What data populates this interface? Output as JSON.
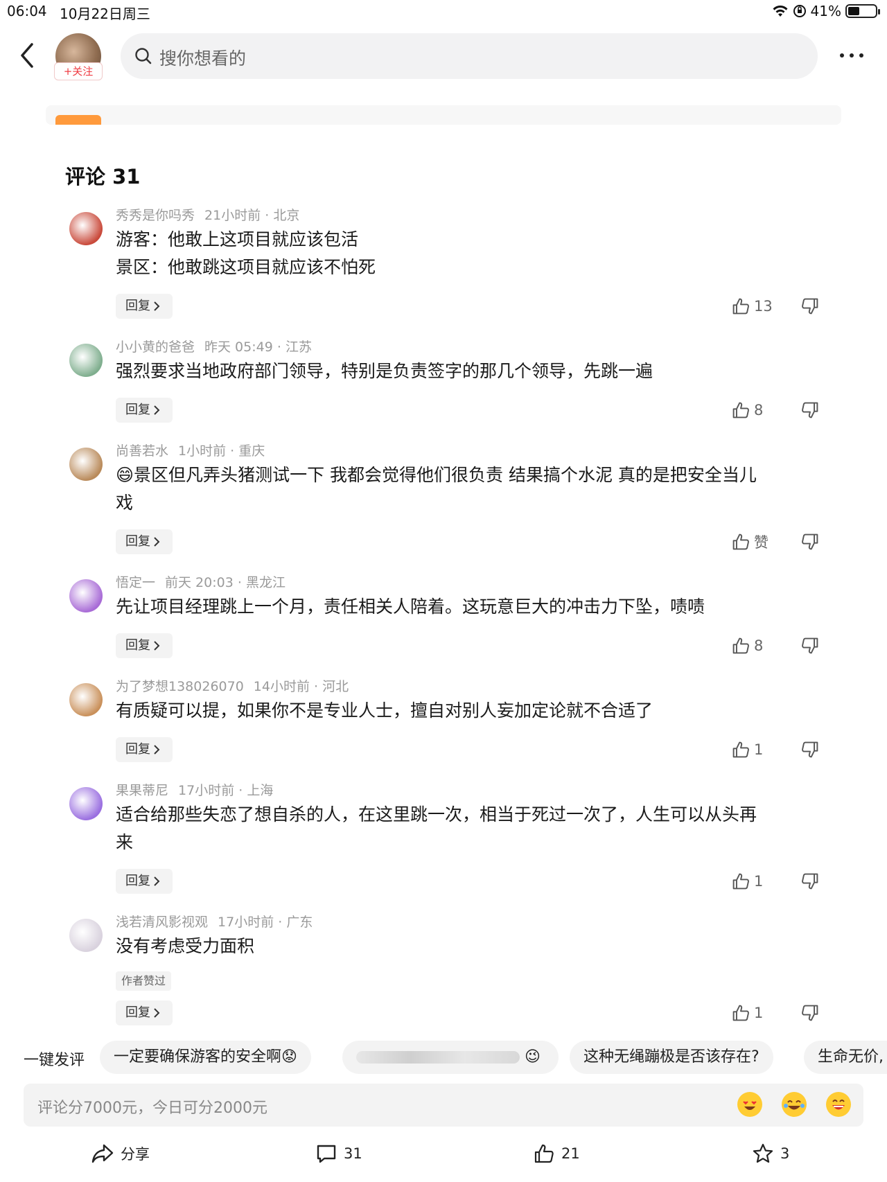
{
  "status_bar": {
    "time": "06:04",
    "date": "10月22日周三",
    "battery_text": "41%",
    "battery_level": 0.41
  },
  "top_nav": {
    "follow_label": "+关注",
    "search_placeholder": "搜你想看的"
  },
  "comments_header": {
    "title": "评论 31"
  },
  "comments": [
    {
      "author": "秀秀是你吗秀",
      "time": "21小时前",
      "location": "北京",
      "lines": [
        "游客：他敢上这项目就应该包活",
        "景区：他敢跳这项目就应该不怕死"
      ],
      "reply_label": "回复",
      "likes": "13",
      "avatar_color": "#c94a3b"
    },
    {
      "author": "小小黄的爸爸",
      "time": "昨天 05:49",
      "location": "江苏",
      "lines": [
        "强烈要求当地政府部门领导，特别是负责签字的那几个领导，先跳一遍"
      ],
      "reply_label": "回复",
      "likes": "8",
      "avatar_color": "#7fae8e"
    },
    {
      "author": "尚善若水",
      "time": "1小时前",
      "location": "重庆",
      "lines": [
        "😄景区但凡弄头猪测试一下 我都会觉得他们很负责 结果搞个水泥 真的是把安全当儿",
        "戏"
      ],
      "reply_label": "回复",
      "likes": "赞",
      "avatar_color": "#b98a5a"
    },
    {
      "author": "悟定一",
      "time": "前天 20:03",
      "location": "黑龙江",
      "lines": [
        "先让项目经理跳上一个月，责任相关人陪着。这玩意巨大的冲击力下坠，啧啧"
      ],
      "reply_label": "回复",
      "likes": "8",
      "avatar_color": "#a86bd6"
    },
    {
      "author": "为了梦想138026070",
      "time": "14小时前",
      "location": "河北",
      "lines": [
        "有质疑可以提，如果你不是专业人士，擅自对别人妄加定论就不合适了"
      ],
      "reply_label": "回复",
      "likes": "1",
      "avatar_color": "#c9905a"
    },
    {
      "author": "果果蒂尼",
      "time": "17小时前",
      "location": "上海",
      "lines": [
        "适合给那些失恋了想自杀的人，在这里跳一次，相当于死过一次了，人生可以从头再",
        "来"
      ],
      "reply_label": "回复",
      "likes": "1",
      "avatar_color": "#9a6fe0"
    },
    {
      "author": "浅若清风影视观",
      "time": "17小时前",
      "location": "广东",
      "lines": [
        "没有考虑受力面积"
      ],
      "badge": "作者赞过",
      "reply_label": "回复",
      "likes": "1",
      "avatar_color": "#d9d2de"
    }
  ],
  "quick_reply": {
    "label": "一键发评",
    "chips": [
      "一定要确保游客的安全啊😟",
      "😉",
      "这种无绳蹦极是否该存在?",
      "生命无价,"
    ]
  },
  "comment_input": {
    "placeholder": "评论分7000元，今日可分2000元"
  },
  "bottom_bar": {
    "share_label": "分享",
    "comments_count": "31",
    "likes_count": "21",
    "favorites_count": "3"
  },
  "icons": {
    "back": "chevron-left-icon",
    "search": "search-icon",
    "more": "more-dots-icon",
    "like": "thumbs-up-icon",
    "dislike": "thumbs-down-icon",
    "share": "share-icon",
    "comment": "comment-bubble-icon",
    "favorite": "star-icon"
  },
  "colors": {
    "follow_red": "#ef3c43",
    "chip_bg": "#f3f3f3"
  }
}
